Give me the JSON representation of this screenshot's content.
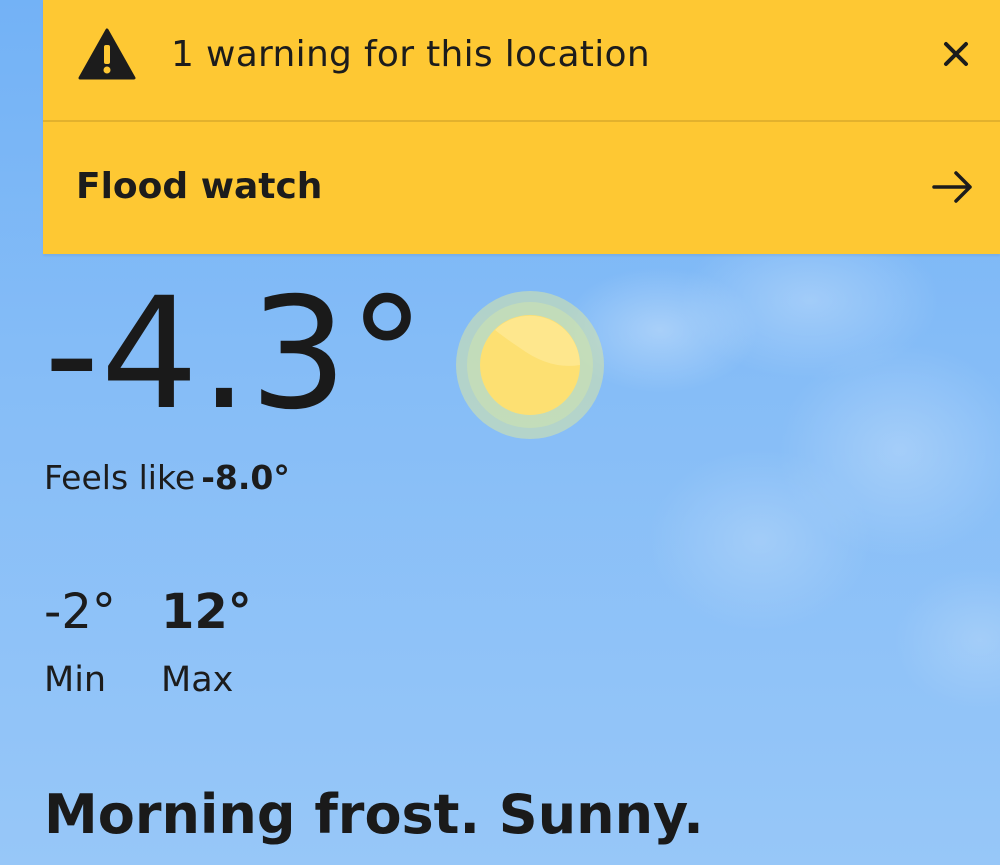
{
  "warnings": {
    "header_text": "1 warning for this location",
    "items": [
      {
        "label": "Flood watch"
      }
    ],
    "banner_color": "#fec833"
  },
  "current": {
    "temperature": "-4.3°",
    "feels_like_label": "Feels like",
    "feels_like_value": "-8.0°",
    "condition_icon": "sun-icon"
  },
  "range": {
    "min_value": "-2°",
    "min_label": "Min",
    "max_value": "12°",
    "max_label": "Max"
  },
  "summary": "Morning frost. Sunny."
}
